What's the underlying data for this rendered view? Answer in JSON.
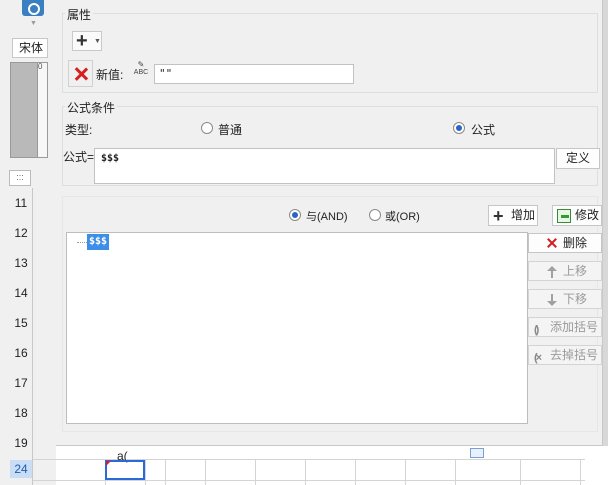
{
  "background": {
    "font_name": "宋体",
    "ruler_zero": "0",
    "row_numbers": [
      "11",
      "12",
      "13",
      "14",
      "15",
      "16",
      "17",
      "18",
      "19",
      "24"
    ],
    "active_row": "24",
    "cell_text": "a("
  },
  "properties": {
    "title": "属性",
    "new_value_label": "新值:",
    "new_value": "\"\"",
    "abc_icon_text": "ABC"
  },
  "formula_condition": {
    "title": "公式条件",
    "type_label": "类型:",
    "option_normal": "普通",
    "option_formula": "公式",
    "selected_type": "公式",
    "formula_label": "公式=",
    "formula_value": "$$$",
    "define_button": "定义"
  },
  "conditions": {
    "and_label": "与(AND)",
    "or_label": "或(OR)",
    "selected_logic": "与(AND)",
    "add_button": "增加",
    "modify_button": "修改",
    "tree_items": [
      "$$$"
    ],
    "delete_button": "删除",
    "move_up_button": "上移",
    "move_down_button": "下移",
    "add_bracket_button": "添加括号",
    "remove_bracket_button": "去掉括号"
  },
  "colors": {
    "accent": "#2a64c8",
    "selection": "#3d8ee8",
    "delete_red": "#d42020"
  }
}
